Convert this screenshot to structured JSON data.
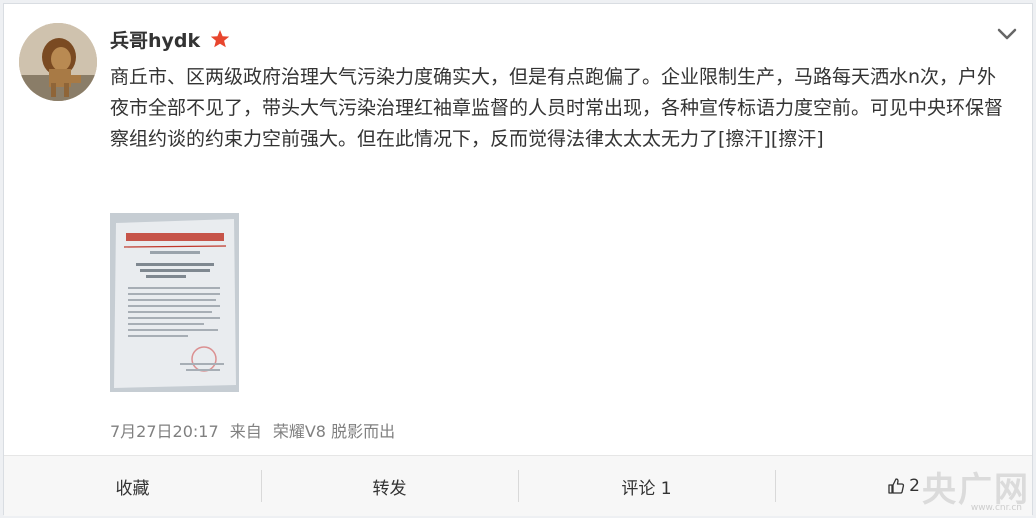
{
  "post": {
    "author": "兵哥hydk",
    "verified_badge_icon": "red-star-icon",
    "text": "商丘市、区两级政府治理大气污染力度确实大，但是有点跑偏了。企业限制生产，马路每天洒水n次，户外夜市全部不见了，带头大气污染治理红袖章监督的人员时常出现，各种宣传标语力度空前。可见中央环保督察组约谈的约束力空前强大。但在此情况下，反而觉得法律太太太无力了[擦汗][擦汗]",
    "timestamp": "7月27日20:17",
    "source_prefix": "来自",
    "source": "荣耀V8 脱影而出"
  },
  "actions": {
    "favorite": "收藏",
    "repost": "转发",
    "comment": "评论 1",
    "like_count": "2"
  },
  "watermark": {
    "logo_text": "央广网",
    "url": "www.cnr.cn"
  },
  "colors": {
    "text": "#333333",
    "meta": "#808080",
    "star": "#e8462e",
    "document_header_red": "#c0392b"
  }
}
